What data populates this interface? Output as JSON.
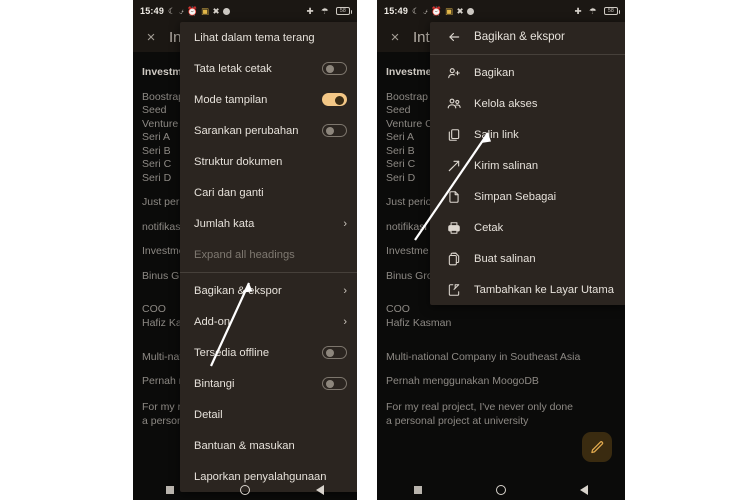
{
  "statusbar": {
    "time": "15:49",
    "icons": [
      "moon-icon",
      "vibrate-off-icon",
      "alarm-icon",
      "gallery-icon",
      "x-app-icon",
      "dot-icon"
    ],
    "right_icons": [
      "airplane-icon",
      "wifi-icon",
      "battery-icon"
    ],
    "battery_level": "58"
  },
  "appbar": {
    "close_label": "×",
    "title": "Inte"
  },
  "document": {
    "heading": "Investme",
    "lines": [
      "Boostrap",
      "Seed",
      "Venture C",
      "Seri A",
      "Seri B",
      "Seri C",
      "Seri D"
    ],
    "line_just": "Just perio",
    "line_notif": "notifikasi",
    "line_invest": "Investme",
    "line_binus": "Binus Group",
    "line_coo": "COO",
    "line_coo_name": "Hafiz Kasman",
    "line_multi": "Multi-national Company in Southeast Asia",
    "line_moogo": "Pernah menggunakan MoogoDB",
    "line_footer1": "For my real project, I've never only done",
    "line_footer2": "a personal project at university"
  },
  "left_menu": {
    "items": [
      {
        "label": "Lihat dalam tema terang",
        "type": "plain"
      },
      {
        "label": "Tata letak cetak",
        "type": "toggle",
        "on": false
      },
      {
        "label": "Mode tampilan",
        "type": "toggle",
        "on": true
      },
      {
        "label": "Sarankan perubahan",
        "type": "toggle",
        "on": false
      },
      {
        "label": "Struktur dokumen",
        "type": "plain"
      },
      {
        "label": "Cari dan ganti",
        "type": "plain"
      },
      {
        "label": "Jumlah kata",
        "type": "submenu",
        "chev": "›"
      },
      {
        "label": "Expand all headings",
        "type": "disabled"
      },
      {
        "label": "Bagikan & ekspor",
        "type": "submenu",
        "chev": "›"
      },
      {
        "label": "Add-on",
        "type": "submenu",
        "chev": "›"
      },
      {
        "label": "Tersedia offline",
        "type": "toggle",
        "on": false
      },
      {
        "label": "Bintangi",
        "type": "toggle",
        "on": false
      },
      {
        "label": "Detail",
        "type": "plain"
      },
      {
        "label": "Bantuan & masukan",
        "type": "plain"
      },
      {
        "label": "Laporkan penyalahgunaan",
        "type": "plain"
      }
    ]
  },
  "right_menu": {
    "header": {
      "label": "Bagikan & ekspor",
      "icon": "back-arrow-icon"
    },
    "items": [
      {
        "label": "Bagikan",
        "icon": "person-add-icon"
      },
      {
        "label": "Kelola akses",
        "icon": "people-icon"
      },
      {
        "label": "Salin link",
        "icon": "copy-link-icon"
      },
      {
        "label": "Kirim salinan",
        "icon": "send-icon"
      },
      {
        "label": "Simpan Sebagai",
        "icon": "save-file-icon"
      },
      {
        "label": "Cetak",
        "icon": "printer-icon"
      },
      {
        "label": "Buat salinan",
        "icon": "duplicate-icon"
      },
      {
        "label": "Tambahkan ke Layar Utama",
        "icon": "add-to-homescreen-icon"
      }
    ]
  },
  "fab": {
    "icon": "edit-pencil-icon"
  },
  "navbar": {
    "buttons": [
      "recents-square-icon",
      "home-circle-icon",
      "back-triangle-icon"
    ]
  },
  "annotations": {
    "left_arrow_target": "Bagikan & ekspor",
    "right_arrow_target": "Salin link",
    "color": "#ffffff"
  },
  "colors": {
    "page_background": "#ffffff",
    "phone_background": "#0b0b0a",
    "appbar": "#1b1713",
    "menu_surface": "#2b2520",
    "accent_toggle_on": "#f3c786",
    "fab_background": "#3a2b10",
    "fab_icon": "#e0a94e",
    "text_primary": "#e6e1da",
    "text_secondary": "#8d8984",
    "text_disabled": "#7e7870"
  }
}
